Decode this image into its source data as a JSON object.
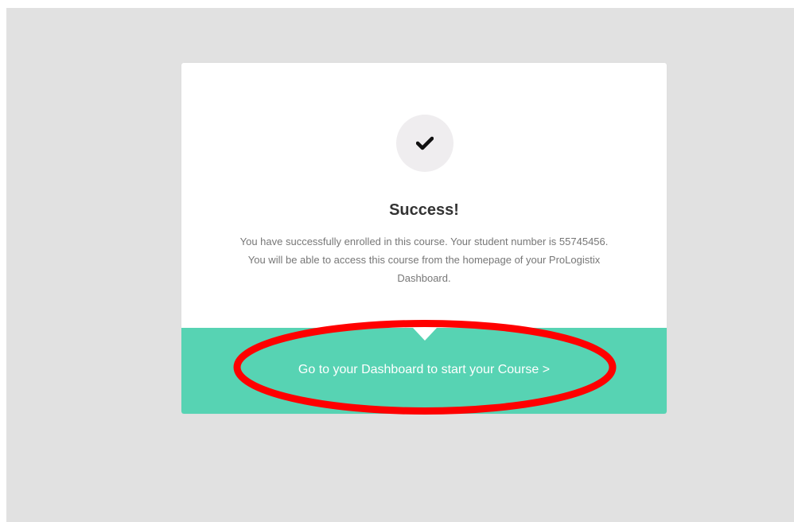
{
  "modal": {
    "icon": "checkmark-icon",
    "title": "Success!",
    "message_line1": "You have successfully enrolled in this course. Your student number is 55745456.",
    "message_line2": "You will be able to access this course from the homepage of your ProLogistix",
    "message_line3": "Dashboard.",
    "cta_label": "Go to your Dashboard to start your Course >"
  },
  "annotation": {
    "type": "red-ellipse-highlight",
    "color": "#ff0000"
  },
  "colors": {
    "backdrop": "#e1e1e1",
    "modal_bg": "#ffffff",
    "footer_bg": "#57d3b3",
    "icon_circle": "#efedef",
    "title": "#333333",
    "message": "#777777",
    "cta_text": "#ffffff"
  }
}
